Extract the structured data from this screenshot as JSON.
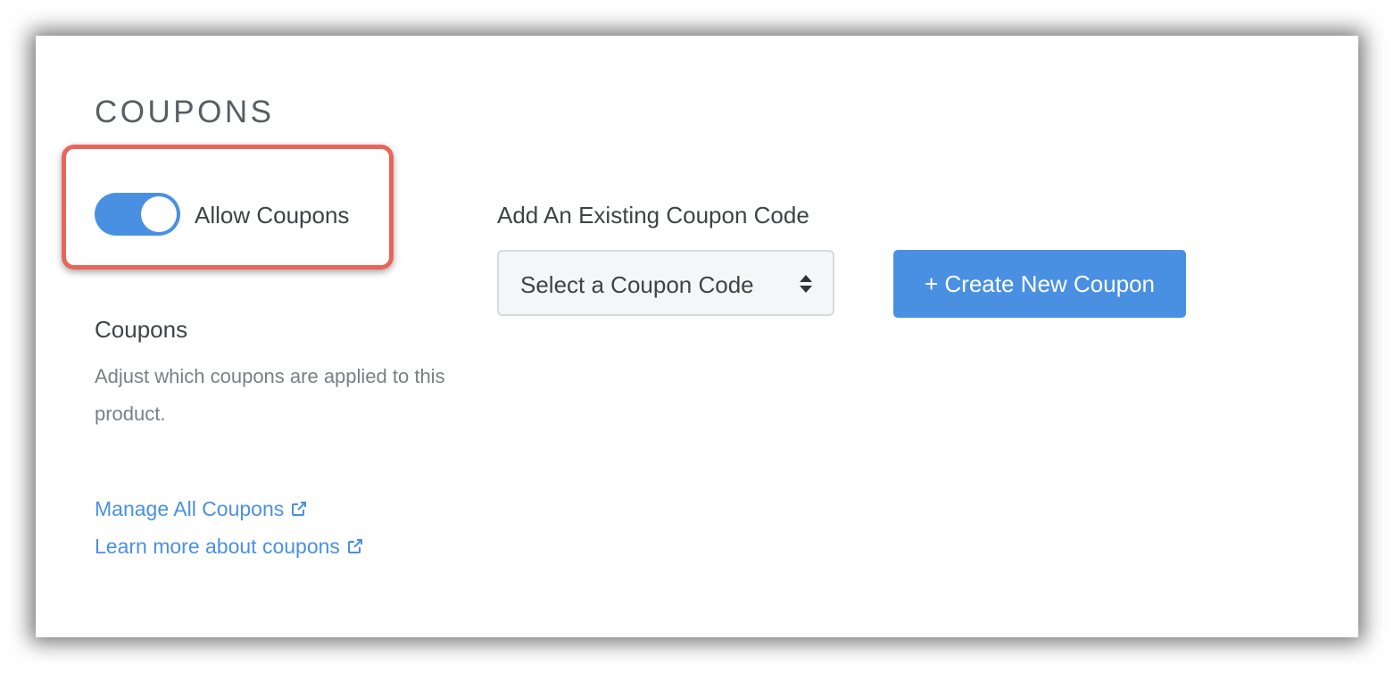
{
  "section": {
    "title": "COUPONS"
  },
  "toggle": {
    "label": "Allow Coupons",
    "state": "on"
  },
  "info": {
    "heading": "Coupons",
    "description": "Adjust which coupons are applied to this product."
  },
  "links": {
    "manage_all": "Manage All Coupons",
    "learn_more": "Learn more about coupons"
  },
  "coupon_select": {
    "label": "Add An Existing Coupon Code",
    "placeholder": "Select a Coupon Code"
  },
  "create_button": {
    "label": "+ Create New Coupon"
  },
  "icons": {
    "external_link": "external-link-icon",
    "select_arrows": "sort-arrows-icon"
  },
  "colors": {
    "accent": "#4a90e2",
    "highlight": "#e8655a",
    "title_text": "#595d64",
    "body_text": "#3f4347",
    "muted_text": "#7a7f86"
  }
}
